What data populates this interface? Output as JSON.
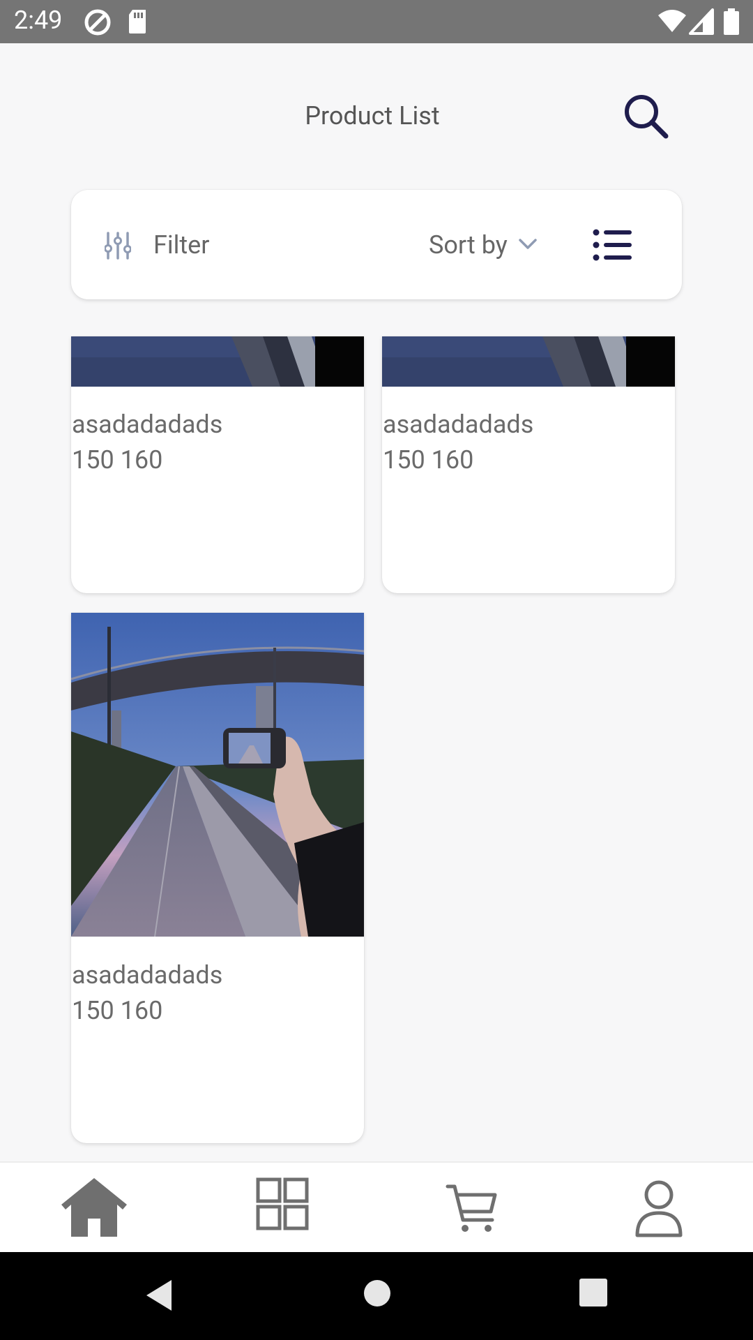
{
  "status_bar": {
    "time": "2:49",
    "icons": [
      "at-sign-icon",
      "sd-card-icon",
      "wifi-icon",
      "signal-icon",
      "battery-icon"
    ]
  },
  "header": {
    "title": "Product List",
    "search_icon": "search-icon"
  },
  "toolbar": {
    "filter_label": "Filter",
    "sort_label": "Sort by",
    "view_icon": "list-view-icon"
  },
  "products": [
    {
      "name": "asadadadads",
      "price": "150 160"
    },
    {
      "name": "asadadadads",
      "price": "150 160"
    },
    {
      "name": "asadadadads",
      "price": "150 160"
    }
  ],
  "bottom_nav": {
    "items": [
      "home-icon",
      "categories-icon",
      "cart-icon",
      "profile-icon"
    ],
    "active": "home-icon"
  },
  "system_nav": [
    "back-icon",
    "home-circle-icon",
    "recents-icon"
  ],
  "colors": {
    "accent_dark": "#1f1d4d",
    "muted_icon": "#8f9bb3",
    "status_bar": "#757575",
    "nav_icon": "#6f6f6f",
    "background": "#f7f7f8"
  }
}
